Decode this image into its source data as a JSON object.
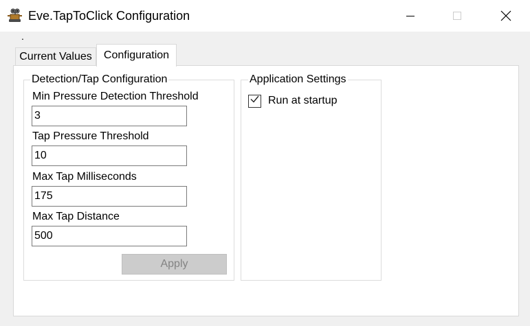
{
  "window": {
    "title": "Eve.TapToClick Configuration",
    "icon": "wall-e-robot-icon"
  },
  "caption": {
    "minimize_icon": "minimize-icon",
    "maximize_icon": "maximize-icon",
    "close_icon": "close-icon"
  },
  "dot_label": ".",
  "tabs": [
    {
      "label": "Current Values",
      "selected": false
    },
    {
      "label": "Configuration",
      "selected": true
    }
  ],
  "detection_group": {
    "title": "Detection/Tap Configuration",
    "fields": [
      {
        "label": "Min Pressure Detection Threshold",
        "value": "3"
      },
      {
        "label": "Tap Pressure Threshold",
        "value": "10"
      },
      {
        "label": "Max Tap Milliseconds",
        "value": "175"
      },
      {
        "label": "Max Tap Distance",
        "value": "500"
      }
    ],
    "apply_label": "Apply",
    "apply_enabled": false
  },
  "app_group": {
    "title": "Application Settings",
    "run_at_startup_label": "Run at startup",
    "run_at_startup_checked": true
  },
  "colors": {
    "titlebar_bg": "#ffffff",
    "window_bg": "#f0f0f0",
    "panel_bg": "#ffffff",
    "disabled_button_bg": "#cccccc",
    "disabled_button_text": "#838383"
  }
}
